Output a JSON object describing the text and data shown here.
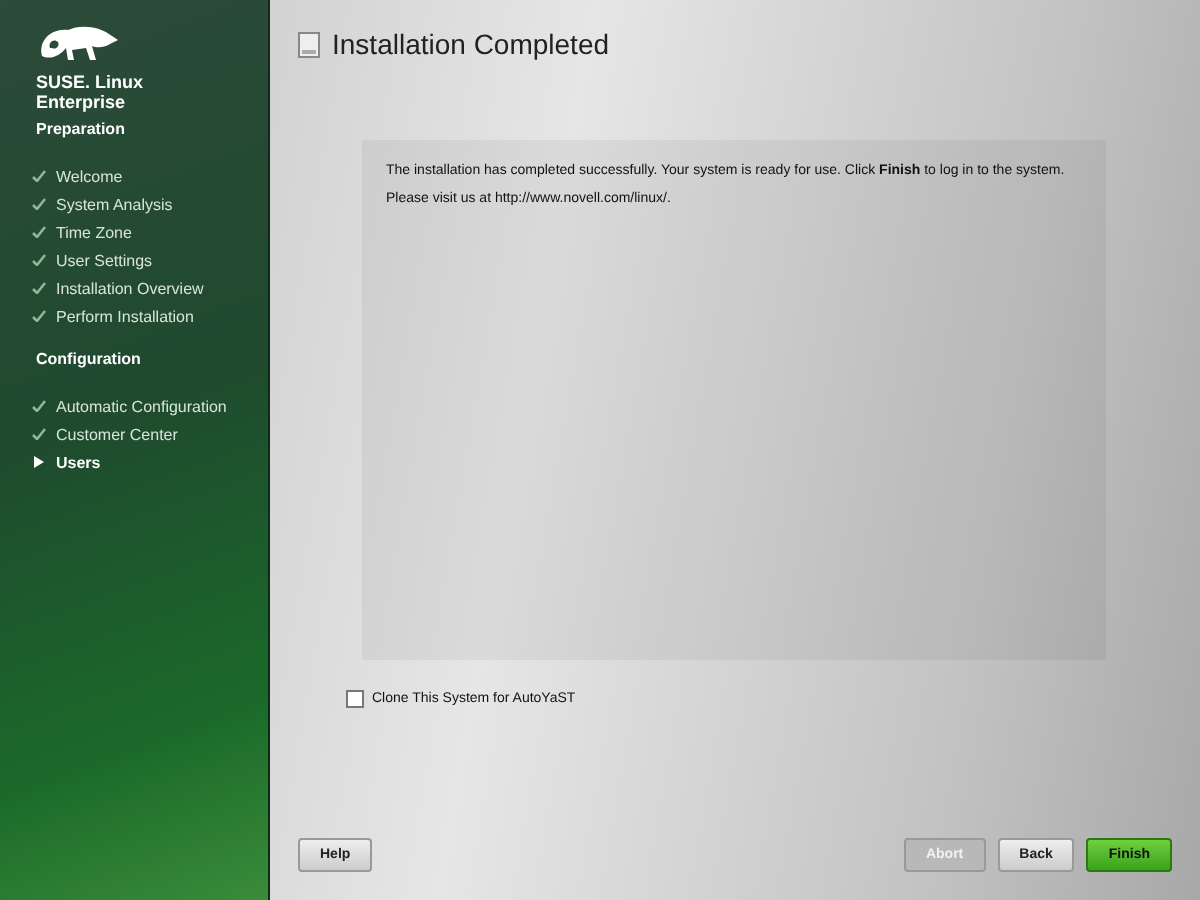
{
  "brand": {
    "line_1": "SUSE. Linux",
    "line_2": "Enterprise"
  },
  "sections": [
    {
      "title": "Preparation",
      "steps": [
        {
          "label": "Welcome",
          "kind": "done"
        },
        {
          "label": "System Analysis",
          "kind": "done"
        },
        {
          "label": "Time Zone",
          "kind": "done"
        },
        {
          "label": "User Settings",
          "kind": "done"
        },
        {
          "label": "Installation Overview",
          "kind": "done"
        },
        {
          "label": "Perform Installation",
          "kind": "done"
        }
      ]
    },
    {
      "title": "Configuration",
      "steps": [
        {
          "label": "Automatic Configuration",
          "kind": "done"
        },
        {
          "label": "Customer Center",
          "kind": "done"
        },
        {
          "label": "Users",
          "kind": "current"
        }
      ]
    }
  ],
  "page_title": "Installation Completed",
  "message": [
    "The installation has completed successfully. Your system is ready for use. Click **Finish** to log in to the system.",
    "Please visit us at http://www.novell.com/linux/."
  ],
  "clone_option": {
    "label": "Clone This System for AutoYaST",
    "checked": false
  },
  "help_button": {
    "label": "Help"
  },
  "nav_buttons": [
    {
      "label": "Abort",
      "kind": "plain",
      "disabled": true
    },
    {
      "label": "Back",
      "kind": "plain",
      "disabled": false
    },
    {
      "label": "Finish",
      "kind": "primary",
      "disabled": false
    }
  ]
}
